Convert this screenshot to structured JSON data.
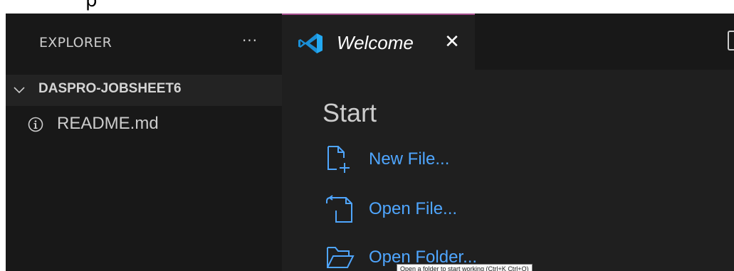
{
  "sidebar": {
    "title": "EXPLORER",
    "more_actions": "···",
    "folder": {
      "name": "DASPRO-JOBSHEET6",
      "expanded": true
    },
    "files": [
      {
        "name": "README.md",
        "icon": "info-icon"
      }
    ]
  },
  "tabs": [
    {
      "label": "Welcome",
      "icon": "vscode-logo-icon",
      "close": "✕",
      "active": true
    }
  ],
  "editor": {
    "heading": "Start",
    "items": [
      {
        "label": "New File...",
        "icon": "new-file-icon"
      },
      {
        "label": "Open File...",
        "icon": "open-file-icon"
      },
      {
        "label": "Open Folder...",
        "icon": "open-folder-icon"
      }
    ],
    "tooltip": "Open a folder to start working (Ctrl+K Ctrl+O)"
  },
  "colors": {
    "sidebar_bg": "#181818",
    "editor_bg": "#1f1f1f",
    "link": "#4fa6ff",
    "active_tab_border": "#a44c8c",
    "vscode_blue": "#23a9f2"
  }
}
